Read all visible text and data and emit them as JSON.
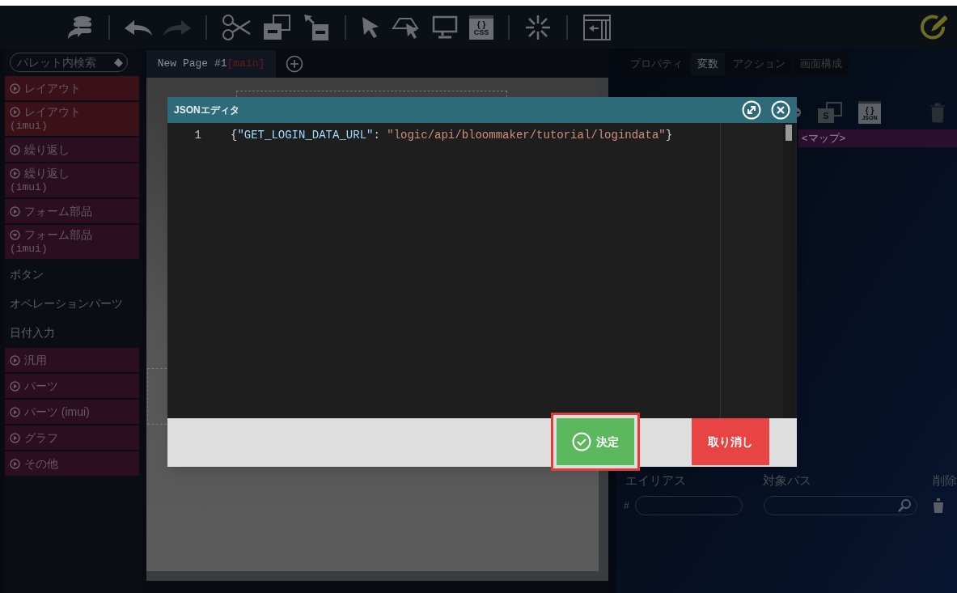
{
  "toolbar": [
    {
      "kind": "db"
    },
    {
      "kind": "sep"
    },
    {
      "kind": "undo",
      "disabled": false
    },
    {
      "kind": "redo",
      "disabled": true
    },
    {
      "kind": "sep"
    },
    {
      "kind": "cut"
    },
    {
      "kind": "copy"
    },
    {
      "kind": "paste"
    },
    {
      "kind": "sep"
    },
    {
      "kind": "pointer"
    },
    {
      "kind": "area"
    },
    {
      "kind": "monitor"
    },
    {
      "kind": "css",
      "label": "{ }",
      "sublabel": "CSS"
    },
    {
      "kind": "sep"
    },
    {
      "kind": "spark"
    },
    {
      "kind": "sep"
    },
    {
      "kind": "panel"
    }
  ],
  "palette_search": {
    "placeholder": "パレット内検索"
  },
  "palette": [
    {
      "kind": "category",
      "label": "レイアウト",
      "expanded": false,
      "color": "#3a1119"
    },
    {
      "kind": "category",
      "label": "レイアウト",
      "sub": "(imui)",
      "expanded": false,
      "color": "#3a1119"
    },
    {
      "kind": "category",
      "label": "繰り返し",
      "expanded": false,
      "color": "#2b0f20"
    },
    {
      "kind": "category",
      "label": "繰り返し",
      "sub": "(imui)",
      "expanded": false,
      "color": "#2b0f20"
    },
    {
      "kind": "category",
      "label": "フォーム部品",
      "expanded": false,
      "color": "#2b0f20"
    },
    {
      "kind": "category",
      "label": "フォーム部品",
      "sub": "(imui)",
      "expanded": true,
      "color": "#2b0f20"
    },
    {
      "kind": "item",
      "label": "ボタン"
    },
    {
      "kind": "item",
      "label": "オペレーションパーツ"
    },
    {
      "kind": "item",
      "label": "日付入力"
    },
    {
      "kind": "category",
      "label": "汎用",
      "expanded": false,
      "color": "#2b0f20"
    },
    {
      "kind": "category",
      "label": "パーツ",
      "expanded": false,
      "color": "#2b0f20"
    },
    {
      "kind": "category",
      "label": "パーツ (imui)",
      "expanded": false,
      "color": "#2b0f20"
    },
    {
      "kind": "category",
      "label": "グラフ",
      "expanded": false,
      "color": "#2b0f20"
    },
    {
      "kind": "category",
      "label": "その他",
      "expanded": false,
      "color": "#2b0f20"
    }
  ],
  "page_tab": {
    "label": "New Page #1",
    "branch": "[main]",
    "selected": true
  },
  "right_tabs": [
    {
      "label": "プロパティ",
      "selected": false
    },
    {
      "label": "変数",
      "selected": true
    },
    {
      "label": "アクション",
      "selected": false
    },
    {
      "label": "画面構成",
      "selected": false
    }
  ],
  "variables": {
    "json_icon": {
      "label": "{ }",
      "sublabel": "JSON"
    },
    "copy_icon_label": "S",
    "row": "<マップ>",
    "columns": [
      "エイリアス",
      "対象パス",
      "削除"
    ],
    "alias_prefix": "#"
  },
  "dialog": {
    "title": "JSONエディタ",
    "lines": [
      {
        "number": "1",
        "tokens": [
          {
            "kind": "punct",
            "text": "{"
          },
          {
            "kind": "key",
            "text": "\"GET_LOGIN_DATA_URL\""
          },
          {
            "kind": "punct",
            "text": ": "
          },
          {
            "kind": "string",
            "text": "\"logic/api/bloommaker/tutorial/logindata\""
          },
          {
            "kind": "punct",
            "text": "}"
          }
        ]
      }
    ],
    "buttons": [
      {
        "kind": "ok",
        "label": "決定",
        "highlighted": true
      },
      {
        "kind": "cancel",
        "label": "取り消し",
        "highlighted": false
      }
    ]
  }
}
